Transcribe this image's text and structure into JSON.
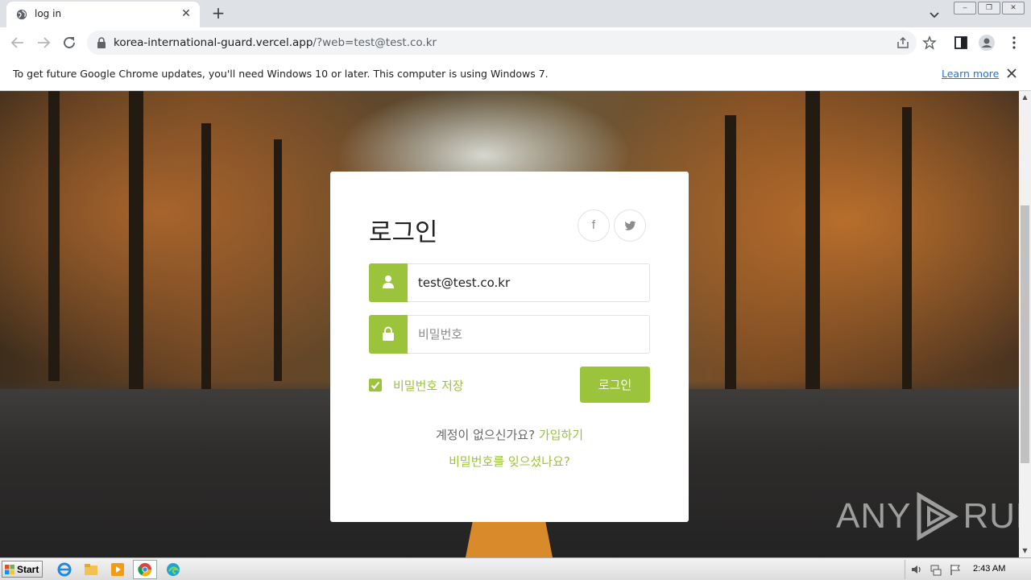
{
  "browser": {
    "tab": {
      "title": "log in",
      "favicon": "globe-icon"
    },
    "url": {
      "host": "korea-international-guard.vercel.app",
      "path": "/?web=test@test.co.kr"
    },
    "infobar": {
      "message": "To get future Google Chrome updates, you'll need Windows 10 or later. This computer is using Windows 7.",
      "link": "Learn more"
    }
  },
  "login": {
    "title": "로그인",
    "social": [
      {
        "label": "f",
        "icon": "facebook-icon"
      },
      {
        "label": "t",
        "icon": "twitter-icon"
      }
    ],
    "email_value": "test@test.co.kr",
    "password_placeholder": "비밀번호",
    "remember_label": "비밀번호 저장",
    "remember_checked": true,
    "submit_label": "로그인",
    "no_account": "계정이 없으신가요?",
    "signup_link": "가입하기",
    "forgot_link": "비밀번호를 잊으셨나요?"
  },
  "colors": {
    "accent": "#9cc33c"
  },
  "watermark": {
    "left": "ANY",
    "right": "RUN"
  },
  "taskbar": {
    "start_label": "Start",
    "clock": "2:43 AM"
  }
}
